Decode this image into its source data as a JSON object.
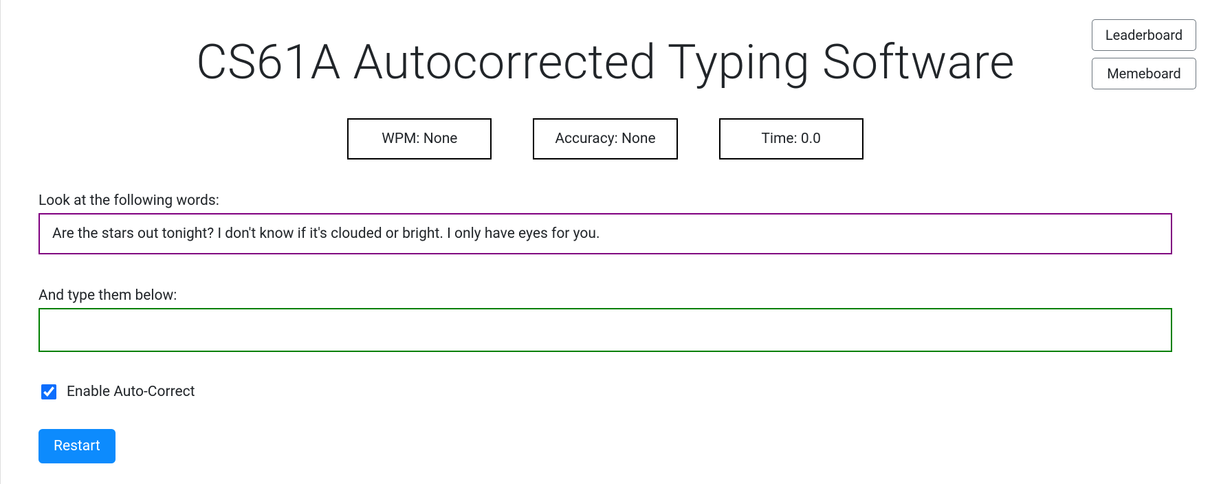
{
  "title": {
    "word1_first": "C",
    "word1_rest": "S61A",
    "word2_first": "A",
    "word2_rest": "utocorrected",
    "word3_first": "T",
    "word3_rest": "yping",
    "word4_first": "S",
    "word4_rest": "oftware"
  },
  "top_buttons": {
    "leaderboard": "Leaderboard",
    "memeboard": "Memeboard"
  },
  "stats": {
    "wpm_label": "WPM: ",
    "wpm_value": "None",
    "accuracy_label": "Accuracy: ",
    "accuracy_value": "None",
    "time_label": "Time: ",
    "time_value": "0.0"
  },
  "prompt": {
    "label": "Look at the following words:",
    "text": "Are the stars out tonight? I don't know if it's clouded or bright. I only have eyes for you."
  },
  "input": {
    "label": "And type them below:",
    "value": ""
  },
  "autocorrect": {
    "label": "Enable Auto-Correct",
    "checked": true
  },
  "restart": {
    "label": "Restart"
  }
}
